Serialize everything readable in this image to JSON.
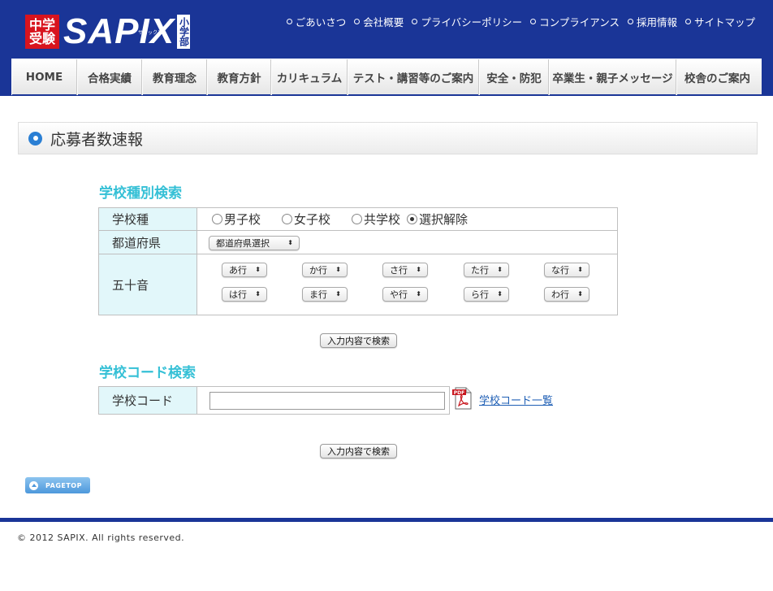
{
  "brand": {
    "badge_top": "中学",
    "badge_bottom": "受験",
    "name": "SAPIX",
    "name_sub": "サピックス",
    "tag": "小学部"
  },
  "top_nav": [
    {
      "label": "ごあいさつ"
    },
    {
      "label": "会社概要"
    },
    {
      "label": "プライバシーポリシー"
    },
    {
      "label": "コンプライアンス"
    },
    {
      "label": "採用情報"
    },
    {
      "label": "サイトマップ"
    }
  ],
  "main_nav": [
    {
      "label": "HOME"
    },
    {
      "label": "合格実績"
    },
    {
      "label": "教育理念"
    },
    {
      "label": "教育方針"
    },
    {
      "label": "カリキュラム"
    },
    {
      "label": "テスト・講習等のご案内"
    },
    {
      "label": "安全・防犯"
    },
    {
      "label": "卒業生・親子メッセージ"
    },
    {
      "label": "校舎のご案内"
    }
  ],
  "page_title": "応募者数速報",
  "school_type_search": {
    "title": "学校種別検索",
    "type_label": "学校種",
    "type_options": [
      {
        "label": "男子校",
        "checked": false
      },
      {
        "label": "女子校",
        "checked": false
      },
      {
        "label": "共学校",
        "checked": false
      },
      {
        "label": "選択解除",
        "checked": true
      }
    ],
    "prefecture_label": "都道府県",
    "prefecture_value": "都道府県選択",
    "kana_label": "五十音",
    "kana_rows": [
      [
        "あ行",
        "か行",
        "さ行",
        "た行",
        "な行"
      ],
      [
        "は行",
        "ま行",
        "や行",
        "ら行",
        "わ行"
      ]
    ],
    "submit_label": "入力内容で検索"
  },
  "school_code_search": {
    "title": "学校コード検索",
    "code_label": "学校コード",
    "code_value": "",
    "list_link": "学校コード一覧",
    "submit_label": "入力内容で検索"
  },
  "pagetop_label": "PAGETOP",
  "footer": "© 2012 SAPIX. All rights reserved.",
  "colors": {
    "header_blue": "#1a3597",
    "brand_red": "#d8141e",
    "accent_cyan": "#35c0d6",
    "label_bg": "#e2f7fa",
    "link_blue": "#1f5fb5"
  }
}
